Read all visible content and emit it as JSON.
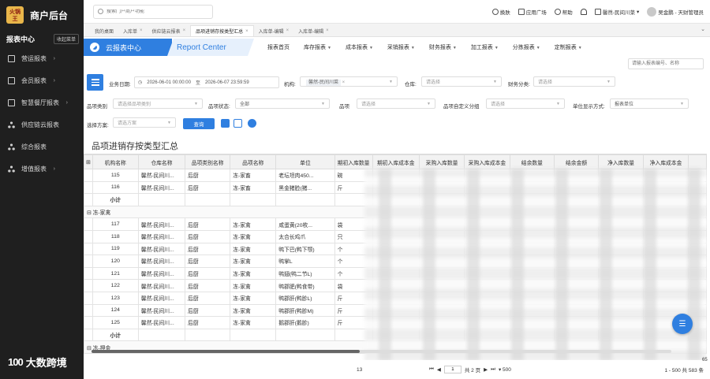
{
  "brand": {
    "logo_top": "火锅",
    "logo_bottom": "王",
    "title": "商户后台"
  },
  "sidebar": {
    "header": "报表中心",
    "collapse": "收起菜单",
    "items": [
      {
        "label": "营运报表",
        "icon": "report-icon"
      },
      {
        "label": "会员报表",
        "icon": "member-icon"
      },
      {
        "label": "智慧餐厅报表",
        "icon": "restaurant-icon"
      },
      {
        "label": "供应链云报表",
        "icon": "supply-chain-icon"
      },
      {
        "label": "综合报表",
        "icon": "summary-icon"
      },
      {
        "label": "增值报表",
        "icon": "value-added-icon"
      }
    ]
  },
  "watermark": {
    "logo": "100",
    "text": "大数跨境"
  },
  "topbar": {
    "search_placeholder": "搜索门户商户功能",
    "actions": [
      "换肤",
      "应用广场",
      "帮助"
    ],
    "store": "馨然-民间川菜",
    "user": "吴金鹏 - 天财管理员"
  },
  "tabs": [
    {
      "label": "我的桌面",
      "closable": false,
      "active": false
    },
    {
      "label": "入库单",
      "closable": true,
      "active": false
    },
    {
      "label": "供应链云报表",
      "closable": true,
      "active": false
    },
    {
      "label": "品项进销存按类型汇总",
      "closable": true,
      "active": true
    },
    {
      "label": "入库单-编辑",
      "closable": true,
      "active": false
    },
    {
      "label": "入库单-编辑",
      "closable": true,
      "active": false
    }
  ],
  "report_center": {
    "title": "云报表中心",
    "subtitle": "Report Center",
    "menu": [
      "报表首页",
      "库存报表",
      "成本报表",
      "采销报表",
      "财务报表",
      "加工报表",
      "分拣报表",
      "定制报表"
    ],
    "search_placeholder": "请输入报表编号、名称"
  },
  "filters": {
    "business_date_label": "业务日期:",
    "date_start": "2026-06-01 00:00:00",
    "date_sep": "至",
    "date_end": "2026-06-07 23:59:59",
    "org_label": "机构:",
    "org_value": "馨然-民间川菜",
    "warehouse_label": "仓库:",
    "warehouse_placeholder": "请选择",
    "finance_label": "财务分类:",
    "finance_placeholder": "请选择",
    "item_category_label": "品项类别",
    "item_category_placeholder": "请选择品项类别",
    "item_status_label": "品项状态:",
    "item_status_value": "全部",
    "item_label": "品项",
    "item_placeholder": "请选择",
    "custom_group_label": "品项自定义分组",
    "custom_group_placeholder": "请选择",
    "unit_display_label": "单位显示方式:",
    "unit_display_value": "报表单位",
    "scheme_label": "选择方案:",
    "scheme_placeholder": "请选方案",
    "query_button": "查询"
  },
  "report_title": "品项进销存按类型汇总",
  "table": {
    "columns": [
      "",
      "机构名称",
      "仓库名称",
      "品项类别名称",
      "品项名称",
      "单位",
      "期初入库数量",
      "期初入库成本金",
      "采购入库数量",
      "采购入库成本金",
      "结余数量",
      "结余金额",
      "净入库数量",
      "净入库成本金"
    ],
    "rows": [
      {
        "type": "data",
        "no": "115",
        "org": "馨然-民间川...",
        "wh": "后厨",
        "cat": "冻-家畜",
        "item": "老坛坦肉450...",
        "unit": "碗"
      },
      {
        "type": "data",
        "no": "116",
        "org": "馨然-民间川...",
        "wh": "后厨",
        "cat": "冻-家畜",
        "item": "黑金猪脸(猪...",
        "unit": "斤"
      },
      {
        "type": "subtotal",
        "label": "小计"
      },
      {
        "type": "group",
        "label": "冻-家禽"
      },
      {
        "type": "data",
        "no": "117",
        "org": "馨然-民间川...",
        "wh": "后厨",
        "cat": "冻-家禽",
        "item": "咸蛋黄(20枚...",
        "unit": "袋"
      },
      {
        "type": "data",
        "no": "118",
        "org": "馨然-民间川...",
        "wh": "后厨",
        "cat": "冻-家禽",
        "item": "太合长鸡爪",
        "unit": "只"
      },
      {
        "type": "data",
        "no": "119",
        "org": "馨然-民间川...",
        "wh": "后厨",
        "cat": "冻-家禽",
        "item": "鸭下巴(鸭下颚)",
        "unit": "个"
      },
      {
        "type": "data",
        "no": "120",
        "org": "馨然-民间川...",
        "wh": "后厨",
        "cat": "冻-家禽",
        "item": "鸭掌L",
        "unit": "个"
      },
      {
        "type": "data",
        "no": "121",
        "org": "馨然-民间川...",
        "wh": "后厨",
        "cat": "冻-家禽",
        "item": "鸭翅(鸭二节L)",
        "unit": "个"
      },
      {
        "type": "data",
        "no": "122",
        "org": "馨然-民间川...",
        "wh": "后厨",
        "cat": "冻-家禽",
        "item": "鸭郡肥(鸭食带)",
        "unit": "袋"
      },
      {
        "type": "data",
        "no": "123",
        "org": "馨然-民间川...",
        "wh": "后厨",
        "cat": "冻-家禽",
        "item": "鸭郡肝(鸭胗L)",
        "unit": "斤"
      },
      {
        "type": "data",
        "no": "124",
        "org": "馨然-民间川...",
        "wh": "后厨",
        "cat": "冻-家禽",
        "item": "鸭郡肝(鸭胗M)",
        "unit": "斤"
      },
      {
        "type": "data",
        "no": "125",
        "org": "馨然-民间川...",
        "wh": "后厨",
        "cat": "冻-家禽",
        "item": "鹅郡肝(鹅胗)",
        "unit": "斤"
      },
      {
        "type": "subtotal",
        "label": "小计"
      },
      {
        "type": "group",
        "label": "冻-押金"
      }
    ]
  },
  "pager": {
    "left_num": "13",
    "page_input": "1",
    "total_pages": "共 2 页",
    "page_size": "500",
    "summary": "1 - 500 共 583 条",
    "right_num": "65"
  },
  "colors": {
    "primary": "#2f7fe0",
    "sidebar": "#1f1f1f",
    "brand_logo": "#e9b64a"
  }
}
